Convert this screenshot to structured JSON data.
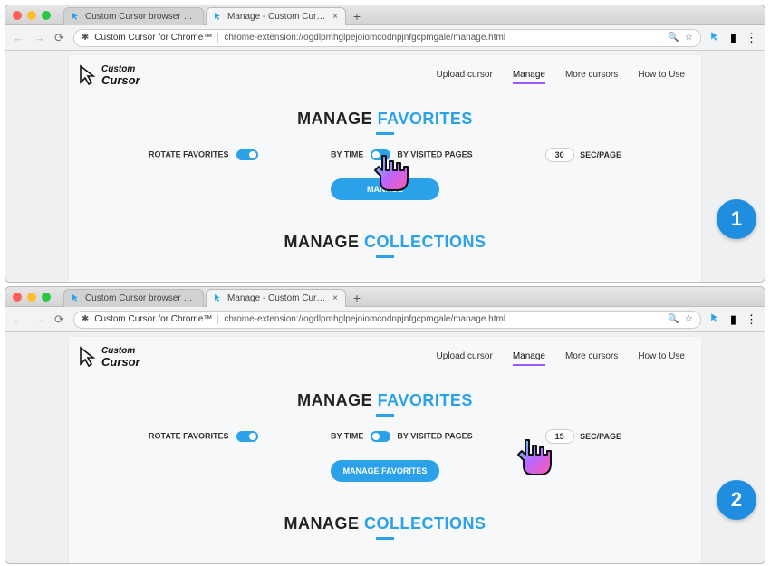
{
  "browser": {
    "tab1": "Custom Cursor browser extensi",
    "tab2": "Manage - Custom Cursor for Ch",
    "site": "Custom Cursor for Chrome™",
    "url": "chrome-extension://ogdlpmhglpejoiomcodnpjnfgcpmgale/manage.html"
  },
  "nav": {
    "upload": "Upload cursor",
    "manage": "Manage",
    "more": "More cursors",
    "how": "How to Use"
  },
  "logo": {
    "top": "Custom",
    "bottom": "Cursor"
  },
  "fav": {
    "title_a": "MANAGE ",
    "title_b": "FAVORITES",
    "rotate": "ROTATE FAVORITES",
    "bytime": "BY TIME",
    "byvisited": "BY VISITED PAGES",
    "secpage": "SEC/PAGE",
    "btn": "MANAGE FAVORITES",
    "btn_short": "MANAGE"
  },
  "col": {
    "title_a": "MANAGE ",
    "title_b": "COLLECTIONS"
  },
  "step1": {
    "sec": "30",
    "badge": "1"
  },
  "step2": {
    "sec": "15",
    "badge": "2"
  }
}
